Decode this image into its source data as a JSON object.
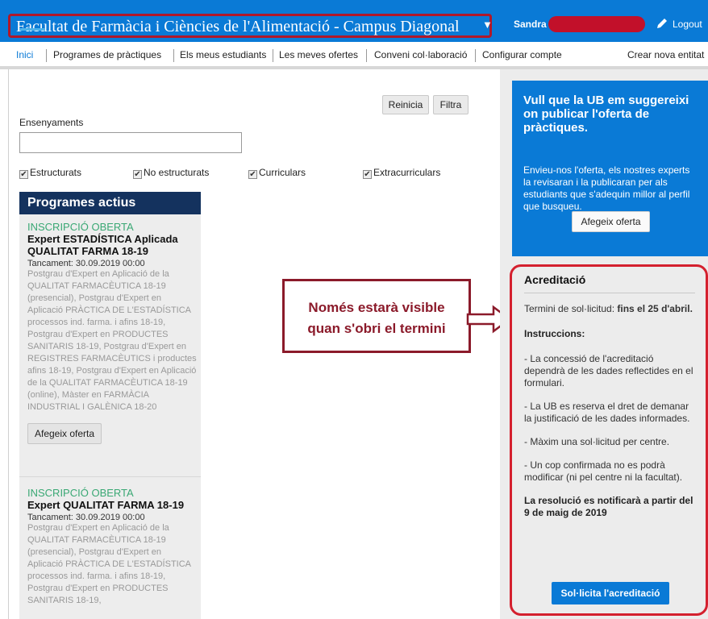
{
  "header": {
    "title": "Facultat de Farmàcia i Ciències de l'Alimentació - Campus Diagonal",
    "user": "Sandra",
    "logout": "Logout"
  },
  "nav": {
    "items": [
      "Inici",
      "Programes de pràctiques",
      "Els meus estudiants",
      "Les meves ofertes",
      "Conveni col·laboració",
      "Configurar compte",
      "Crear nova entitat"
    ]
  },
  "filters": {
    "reset_label": "Reinicia",
    "filter_label": "Filtra",
    "ensenyaments_label": "Ensenyaments",
    "ensenyaments_value": "",
    "checks": [
      "Estructurats",
      "No estructurats",
      "Curriculars",
      "Extracurriculars"
    ]
  },
  "programs": {
    "header": "Programes actius",
    "items": [
      {
        "status": "INSCRIPCIÓ OBERTA",
        "name": "Expert ESTADÍSTICA Aplicada QUALITAT FARMA 18-19",
        "close": "Tancament: 30.09.2019 00:00",
        "desc": "Postgrau d'Expert en Aplicació de la QUALITAT FARMACÈUTICA 18-19 (presencial), Postgrau d'Expert en Aplicació PRÀCTICA DE L'ESTADÍSTICA processos ind. farma. i afins 18-19, Postgrau d'Expert en PRODUCTES SANITARIS 18-19, Postgrau d'Expert en REGISTRES FARMACÈUTICS i productes afins 18-19, Postgrau d'Expert en Aplicació de la QUALITAT FARMACÈUTICA 18-19 (online), Màster en FARMÀCIA INDUSTRIAL I GALÈNICA 18-20",
        "add": "Afegeix oferta"
      },
      {
        "status": "INSCRIPCIÓ OBERTA",
        "name": "Expert QUALITAT FARMA 18-19",
        "close": "Tancament: 30.09.2019 00:00",
        "desc": "Postgrau d'Expert en Aplicació de la QUALITAT FARMACÈUTICA 18-19 (presencial), Postgrau d'Expert en Aplicació PRÀCTICA DE L'ESTADÍSTICA processos ind. farma. i afins 18-19, Postgrau d'Expert en PRODUCTES SANITARIS 18-19,"
      }
    ]
  },
  "callout": {
    "line1": "Només estarà visible",
    "line2": "quan s'obri el termini"
  },
  "suggest": {
    "heading": "Vull que la UB em suggereixi on publicar l'oferta de pràctiques.",
    "body": "Envieu-nos l'oferta, els nostres experts la revisaran i la publicaran per als estudiants que s'adequin millor al perfil que busqueu.",
    "button": "Afegeix oferta"
  },
  "accreditation": {
    "title": "Acreditació",
    "term_prefix": "Termini de sol·licitud: ",
    "term_bold": "fins el 25 d'abril.",
    "instructions_title": "Instruccions:",
    "rules": [
      "- La concessió de l'acreditació dependrà de les dades reflectides en el formulari.",
      "- La UB es reserva el dret de demanar la justificació de les dades informades.",
      "- Màxim una sol·licitud per centre.",
      "- Un cop confirmada no es podrà modificar (ni pel centre ni la facultat)."
    ],
    "resolution": "La resolució es notificarà a partir del 9 de maig de 2019",
    "button": "Sol·licita l'acreditació"
  },
  "colors": {
    "header_blue": "#0a7ad6",
    "programs_navy": "#14325e",
    "status_green": "#3aa874",
    "annotation_red": "#d4202e"
  }
}
